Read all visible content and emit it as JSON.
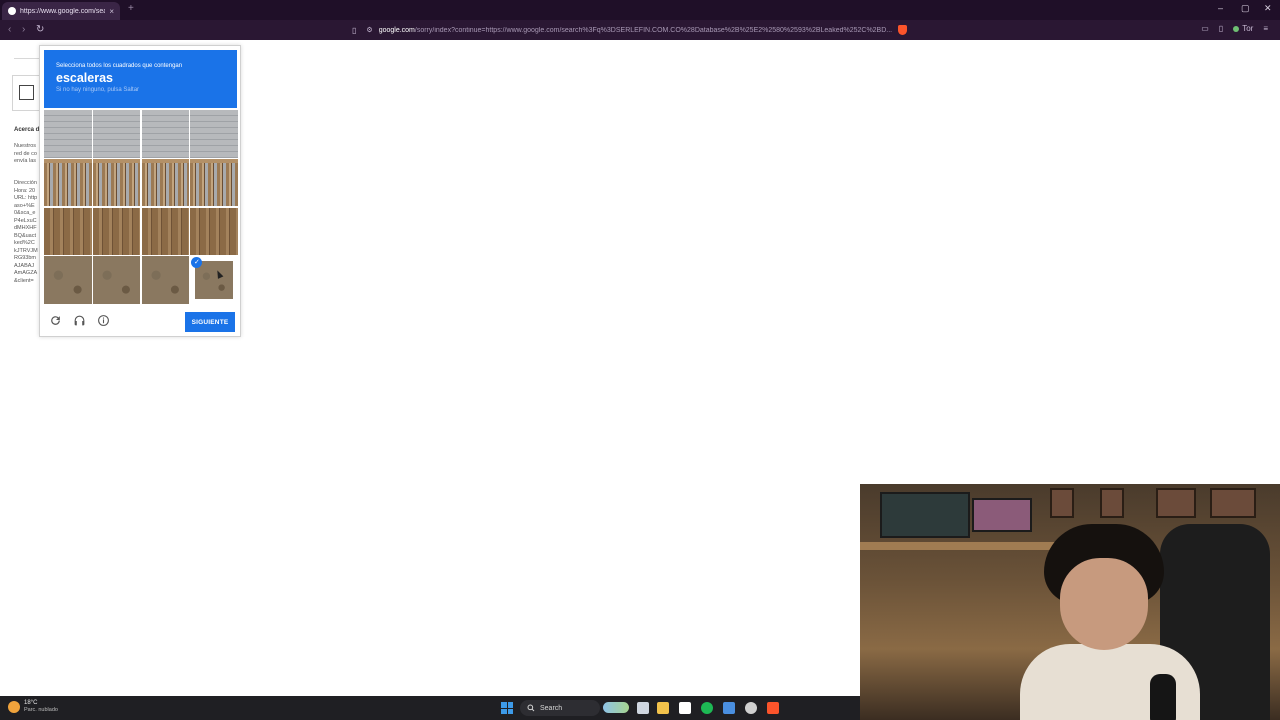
{
  "browser": {
    "tab_title": "https://www.google.com/search?",
    "tab_close": "×",
    "new_tab": "+",
    "url_domain": "google.com",
    "url_path": "/sorry/index?continue=https://www.google.com/search%3Fq%3DSERLEFIN.COM.CO%28Database%2B%25E2%2580%2593%2BLeaked%252C%2BD...",
    "profile_label": "Tor",
    "nav": {
      "back": "‹",
      "forward": "›",
      "reload": "↻"
    },
    "window_controls": {
      "minimize": "–",
      "maximize": "▢",
      "close": "✕"
    }
  },
  "background_page": {
    "heading": "Acerca d",
    "paragraph": [
      "Nuestros",
      "red de co",
      "envía las"
    ],
    "details": [
      "Dirección",
      "Hora: 20",
      "URL: http",
      "aso+%E",
      "0&sca_e",
      "P4eLxuC",
      "dMHXHF",
      "BQ&uact",
      "ked%2C",
      "kJTRVJM",
      "RG93bm",
      "AJABAJ",
      "AmAGZA",
      "&client="
    ]
  },
  "captcha": {
    "instruction": "Selecciona todos los cuadrados que contengan",
    "target_word": "escaleras",
    "hint": "Si no hay ninguno, pulsa Saltar",
    "next_button": "SIGUIENTE",
    "check_mark": "✓",
    "accent_color": "#1a73e8",
    "grid": {
      "rows": 4,
      "cols": 4,
      "selected_tiles": [
        [
          3,
          3
        ]
      ]
    },
    "footer_icons": [
      "reload-icon",
      "headphones-icon",
      "info-icon"
    ]
  },
  "webcam": {
    "description_visible": false
  },
  "taskbar": {
    "weather_temp": "18°C",
    "weather_desc": "Parc. nublado",
    "search_label": "Search",
    "apps": [
      "file-explorer",
      "folder",
      "store",
      "spotify",
      "calculator",
      "chrome",
      "brave"
    ]
  }
}
